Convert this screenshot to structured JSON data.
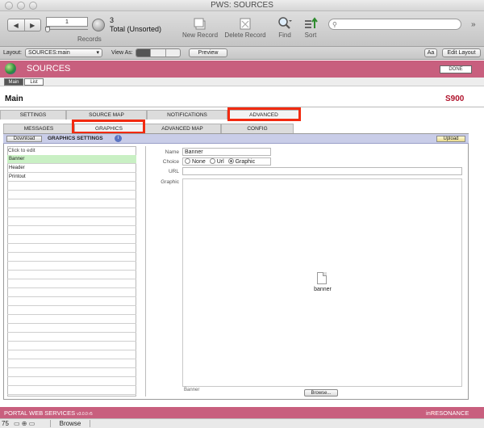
{
  "window": {
    "title": "PWS: SOURCES"
  },
  "toolbar": {
    "record_number": "1",
    "record_count": "3",
    "total_label": "Total (Unsorted)",
    "records_label": "Records",
    "new_record": "New Record",
    "delete_record": "Delete Record",
    "find": "Find",
    "sort": "Sort",
    "search_placeholder": ""
  },
  "layoutbar": {
    "layout_label": "Layout:",
    "layout_value": "SOURCES:main",
    "view_as_label": "View As:",
    "preview": "Preview",
    "font_toggle": "Aa",
    "edit_layout": "Edit Layout"
  },
  "header": {
    "title": "SOURCES",
    "done": "DONE",
    "main_tab": "Main",
    "list_tab": "List",
    "section_title": "Main",
    "record_id": "S900"
  },
  "tabs_primary": [
    "SETTINGS",
    "SOURCE MAP",
    "NOTIFICATIONS",
    "ADVANCED"
  ],
  "tabs_secondary": [
    "MESSAGES",
    "GRAPHICS",
    "ADVANCED MAP",
    "CONFIG"
  ],
  "panel": {
    "download": "Download",
    "title": "GRAPHICS SETTINGS",
    "upload": "Upload",
    "click_to_edit": "Click to edit",
    "items": [
      "Banner",
      "Header",
      "Printout"
    ]
  },
  "form": {
    "name_label": "Name",
    "name_value": "Banner",
    "choice_label": "Choice",
    "choices": [
      "None",
      "Url",
      "Graphic"
    ],
    "selected_choice": "Graphic",
    "url_label": "URL",
    "url_value": "",
    "graphic_label": "Graphic",
    "graphic_file": "banner",
    "bottom_caption": "Banner",
    "browse": "Browse..."
  },
  "footer": {
    "left": "PORTAL WEB SERVICES",
    "version": "v3.0.0 r5",
    "right_prefix": "in",
    "right_accent": "R",
    "right_suffix": "ESONANCE"
  },
  "status": {
    "zoom": "75",
    "mode": "Browse"
  },
  "colors": {
    "band": "#c85f7e",
    "highlight": "#f22a10",
    "selected_row": "#c9f0c4",
    "record_id": "#b0122b"
  }
}
